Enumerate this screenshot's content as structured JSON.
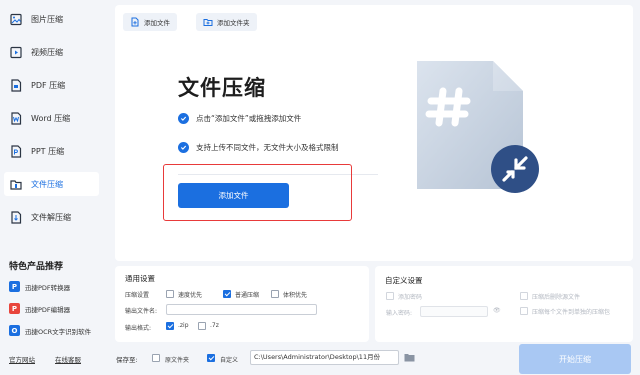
{
  "sidebar": {
    "items": [
      {
        "label": "图片压缩",
        "icon": "image-icon"
      },
      {
        "label": "视频压缩",
        "icon": "video-icon"
      },
      {
        "label": "PDF 压缩",
        "icon": "pdf-icon"
      },
      {
        "label": "Word 压缩",
        "icon": "word-icon"
      },
      {
        "label": "PPT 压缩",
        "icon": "ppt-icon"
      },
      {
        "label": "文件压缩",
        "icon": "folder-icon",
        "active": true
      },
      {
        "label": "文件解压缩",
        "icon": "unzip-icon"
      }
    ],
    "recommend_title": "特色产品推荐",
    "recommend": [
      {
        "label": "迅捷PDF转换器",
        "icon": "pdf-converter-icon",
        "color": "#1b6fe0",
        "glyph": "P"
      },
      {
        "label": "迅捷PDF编辑器",
        "icon": "pdf-editor-icon",
        "color": "#e8453c",
        "glyph": "P"
      },
      {
        "label": "迅捷OCR文字识别软件",
        "icon": "ocr-icon",
        "color": "#1b6fe0",
        "glyph": "O"
      }
    ],
    "links": {
      "official_site": "官方网站",
      "online_service": "在线客服"
    }
  },
  "toolbar": {
    "add_file": "添加文件",
    "add_folder": "添加文件夹"
  },
  "hero": {
    "title": "文件压缩",
    "point1": "点击“添加文件”或拖拽添加文件",
    "point2": "支持上传不同文件，无文件大小及格式限制",
    "add_button": "添加文件"
  },
  "settings": {
    "title": "通用设置",
    "compress_label": "压缩设置",
    "options": [
      {
        "label": "速度优先",
        "checked": false
      },
      {
        "label": "普通压缩",
        "checked": true
      },
      {
        "label": "体积优先",
        "checked": false
      }
    ],
    "output_name_label": "输出文件名:",
    "output_name_value": "",
    "output_format_label": "输出格式:",
    "formats": [
      {
        "label": ".zip",
        "checked": true
      },
      {
        "label": ".7z",
        "checked": false
      }
    ]
  },
  "custom": {
    "title": "自定义设置",
    "add_password": "添加密码",
    "enter_password_label": "输入密码:",
    "password_value": "",
    "delete_source": "压缩后删除源文件",
    "per_file": "压缩每个文件到单独的压缩包"
  },
  "bottom": {
    "save_to": "保存至:",
    "source_folder": "原文件夹",
    "custom": "自定义",
    "source_checked": false,
    "custom_checked": true,
    "path": "C:\\Users\\Administrator\\Desktop\\11月份",
    "start_button": "开始压缩"
  },
  "colors": {
    "accent": "#1b6fe0",
    "highlight_box": "#e83a3a",
    "disabled_button": "#a9c8f3"
  }
}
